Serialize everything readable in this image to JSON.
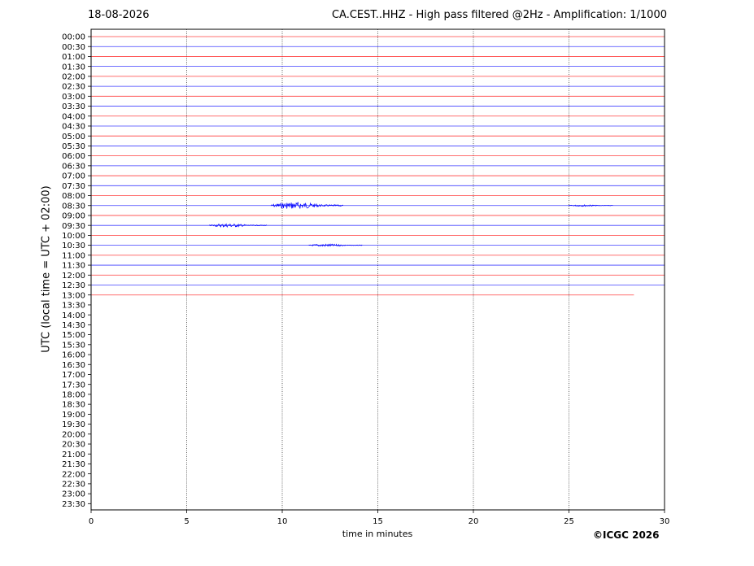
{
  "header": {
    "date": "18-08-2026",
    "title": "CA.CEST..HHZ - High pass filtered @2Hz - Amplification: 1/1000"
  },
  "footer": {
    "copyright": "©ICGC 2026"
  },
  "colors": {
    "odd_trace": "#ff0000",
    "even_trace": "#0000ff",
    "grid": "#000000"
  },
  "chart_data": {
    "type": "line",
    "xlabel": "time in minutes",
    "ylabel": "UTC (local time = UTC + 02:00)",
    "xlim": [
      0,
      30
    ],
    "x_ticks": [
      0,
      5,
      10,
      15,
      20,
      25,
      30
    ],
    "x_grid": "vertical dotted lines at 5, 10, 15, 20, 25",
    "row_labels": [
      "00:00",
      "00:30",
      "01:00",
      "01:30",
      "02:00",
      "02:30",
      "03:00",
      "03:30",
      "04:00",
      "04:30",
      "05:00",
      "05:30",
      "06:00",
      "06:30",
      "07:00",
      "07:30",
      "08:00",
      "08:30",
      "09:00",
      "09:30",
      "10:00",
      "10:30",
      "11:00",
      "11:30",
      "12:00",
      "12:30",
      "13:00",
      "13:30",
      "14:00",
      "14:30",
      "15:00",
      "15:30",
      "16:00",
      "16:30",
      "17:00",
      "17:30",
      "18:00",
      "18:30",
      "19:00",
      "19:30",
      "20:00",
      "20:30",
      "21:00",
      "21:30",
      "22:00",
      "22:30",
      "23:00",
      "23:30"
    ],
    "traces": [
      {
        "row": "00:00",
        "color": "red",
        "end_min": 30
      },
      {
        "row": "00:30",
        "color": "blue",
        "end_min": 30
      },
      {
        "row": "01:00",
        "color": "red",
        "end_min": 30
      },
      {
        "row": "01:30",
        "color": "blue",
        "end_min": 30
      },
      {
        "row": "02:00",
        "color": "red",
        "end_min": 30
      },
      {
        "row": "02:30",
        "color": "blue",
        "end_min": 30
      },
      {
        "row": "03:00",
        "color": "red",
        "end_min": 30
      },
      {
        "row": "03:30",
        "color": "blue",
        "end_min": 30
      },
      {
        "row": "04:00",
        "color": "red",
        "end_min": 30
      },
      {
        "row": "04:30",
        "color": "blue",
        "end_min": 30
      },
      {
        "row": "05:00",
        "color": "red",
        "end_min": 30
      },
      {
        "row": "05:30",
        "color": "blue",
        "end_min": 30
      },
      {
        "row": "06:00",
        "color": "red",
        "end_min": 30
      },
      {
        "row": "06:30",
        "color": "blue",
        "end_min": 30
      },
      {
        "row": "07:00",
        "color": "red",
        "end_min": 30
      },
      {
        "row": "07:30",
        "color": "blue",
        "end_min": 30
      },
      {
        "row": "08:00",
        "color": "red",
        "end_min": 30
      },
      {
        "row": "08:30",
        "color": "blue",
        "end_min": 30
      },
      {
        "row": "09:00",
        "color": "red",
        "end_min": 30
      },
      {
        "row": "09:30",
        "color": "blue",
        "end_min": 30
      },
      {
        "row": "10:00",
        "color": "red",
        "end_min": 30
      },
      {
        "row": "10:30",
        "color": "blue",
        "end_min": 30
      },
      {
        "row": "11:00",
        "color": "red",
        "end_min": 30
      },
      {
        "row": "11:30",
        "color": "blue",
        "end_min": 30
      },
      {
        "row": "12:00",
        "color": "red",
        "end_min": 30
      },
      {
        "row": "12:30",
        "color": "blue",
        "end_min": 30
      },
      {
        "row": "13:00",
        "color": "red",
        "end_min": 28.4
      }
    ],
    "events": [
      {
        "row": "08:30",
        "start_min": 9.4,
        "end_min": 13.2,
        "amplitude": 4
      },
      {
        "row": "08:30",
        "start_min": 25.0,
        "end_min": 27.3,
        "amplitude": 1
      },
      {
        "row": "09:30",
        "start_min": 6.2,
        "end_min": 9.2,
        "amplitude": 2
      },
      {
        "row": "10:30",
        "start_min": 11.4,
        "end_min": 14.2,
        "amplitude": 1.5
      }
    ]
  }
}
